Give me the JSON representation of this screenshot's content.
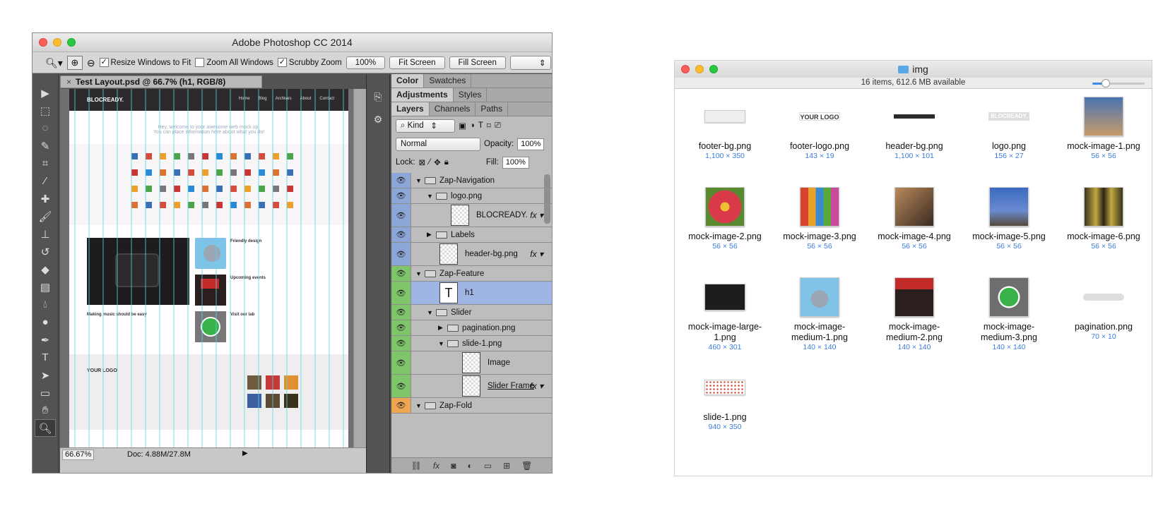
{
  "photoshop": {
    "title": "Adobe Photoshop CC 2014",
    "options": {
      "resize_windows": "Resize Windows to Fit",
      "zoom_all": "Zoom All Windows",
      "scrubby": "Scrubby Zoom",
      "zoom_value": "100%",
      "fit_screen": "Fit Screen",
      "fill_screen": "Fill Screen"
    },
    "doc_tab": "Test Layout.psd @ 66.7% (h1, RGB/8)",
    "status_zoom": "66.67%",
    "status_doc": "Doc: 4.88M/27.8M",
    "canvas": {
      "logo": "BLOCREADY.",
      "menu": [
        "Home",
        "Blog",
        "Archives",
        "About",
        "Contact"
      ],
      "welcome1": "Hey, welcome to your awesome web mock up.",
      "welcome2": "You can place information here about what you do!",
      "friendly": "Friendly design",
      "upcoming": "Upcoming events",
      "visit": "Visit our lab",
      "music": "Making music should be easy",
      "footer_logo": "YOUR LOGO"
    },
    "panel_tabs_1": [
      "Color",
      "Swatches"
    ],
    "panel_tabs_2": [
      "Adjustments",
      "Styles"
    ],
    "panel_tabs_3": [
      "Layers",
      "Channels",
      "Paths"
    ],
    "kind": "Kind",
    "blend_mode": "Normal",
    "opacity_label": "Opacity:",
    "opacity_value": "100%",
    "lock_label": "Lock:",
    "fill_label": "Fill:",
    "fill_value": "100%",
    "layers": [
      {
        "name": "Zap-Navigation"
      },
      {
        "name": "logo.png"
      },
      {
        "name": "BLOCREADY."
      },
      {
        "name": "Labels"
      },
      {
        "name": "header-bg.png"
      },
      {
        "name": "Zap-Feature"
      },
      {
        "name": "h1"
      },
      {
        "name": "Slider"
      },
      {
        "name": "pagination.png"
      },
      {
        "name": "slide-1.png"
      },
      {
        "name": "Image"
      },
      {
        "name": "Slider Frame"
      },
      {
        "name": "Zap-Fold"
      }
    ],
    "fx": "fx"
  },
  "finder": {
    "title": "img",
    "status": "16 items, 612.6 MB available",
    "icon_size_fraction": 0.25,
    "files": [
      {
        "name": "footer-bg.png",
        "dims": "1,100 × 350"
      },
      {
        "name": "footer-logo.png",
        "dims": "143 × 19",
        "label": "YOUR LOGO"
      },
      {
        "name": "header-bg.png",
        "dims": "1,100 × 101"
      },
      {
        "name": "logo.png",
        "dims": "156 × 27",
        "label": "BLOCREADY."
      },
      {
        "name": "mock-image-1.png",
        "dims": "56 × 56"
      },
      {
        "name": "mock-image-2.png",
        "dims": "56 × 56"
      },
      {
        "name": "mock-image-3.png",
        "dims": "56 × 56"
      },
      {
        "name": "mock-image-4.png",
        "dims": "56 × 56"
      },
      {
        "name": "mock-image-5.png",
        "dims": "56 × 56"
      },
      {
        "name": "mock-image-6.png",
        "dims": "56 × 56"
      },
      {
        "name": "mock-image-large-1.png",
        "dims": "460 × 301"
      },
      {
        "name": "mock-image-medium-1.png",
        "dims": "140 × 140"
      },
      {
        "name": "mock-image-medium-2.png",
        "dims": "140 × 140"
      },
      {
        "name": "mock-image-medium-3.png",
        "dims": "140 × 140"
      },
      {
        "name": "pagination.png",
        "dims": "70 × 10"
      },
      {
        "name": "slide-1.png",
        "dims": "940 × 350"
      }
    ]
  },
  "colors": {
    "selection_blue": "#9fb5e4",
    "link_blue": "#3b7dd8",
    "folder_blue": "#5aa8e6"
  }
}
